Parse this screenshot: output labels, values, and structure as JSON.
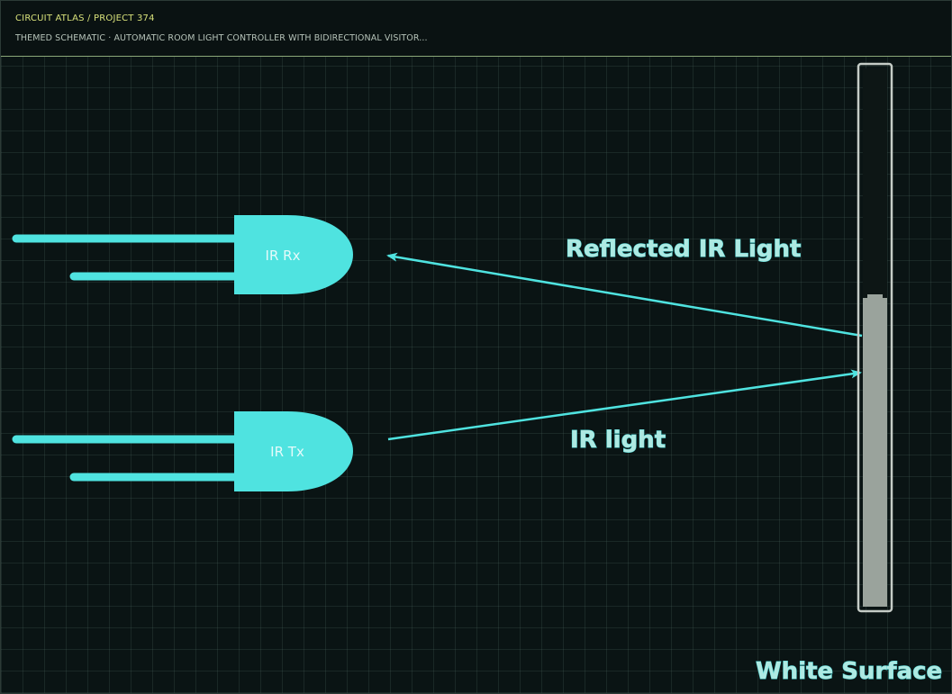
{
  "header": {
    "brand": "CIRCUIT ATLAS / PROJECT 374",
    "subtitle": "THEMED SCHEMATIC · AUTOMATIC ROOM LIGHT CONTROLLER WITH BIDIRECTIONAL VISITOR..."
  },
  "diagram": {
    "receiver_label": "IR Rx",
    "transmitter_label": "IR Tx",
    "reflected_label": "Reflected IR Light",
    "ir_label": "IR light",
    "surface_label": "White Surface"
  },
  "colors": {
    "background": "#0a1414",
    "grid": "#2f4440",
    "accent_cyan": "#4fe3e0",
    "header_rule": "#8aa878",
    "brand": "#d7e07a",
    "surface_fill": "#9aa39c"
  }
}
